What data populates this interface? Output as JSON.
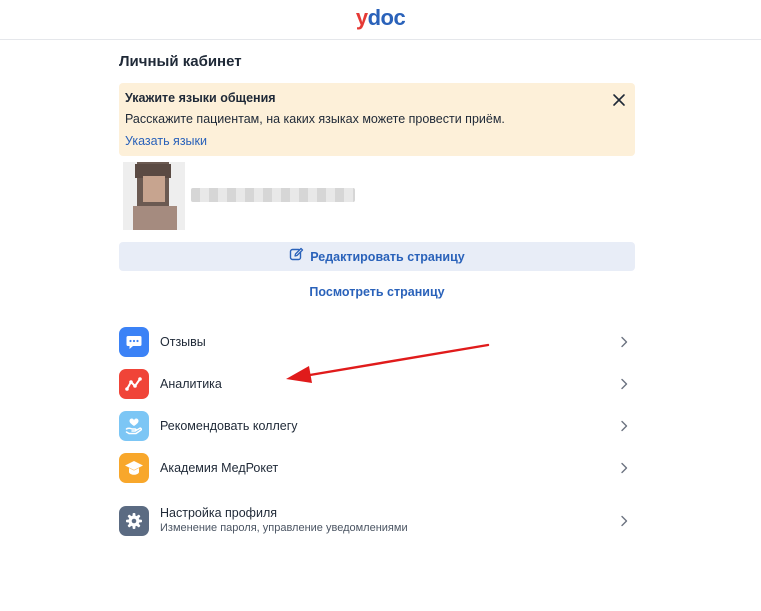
{
  "header": {
    "logo_y": "y",
    "logo_rest": "doc"
  },
  "page": {
    "title": "Личный кабинет"
  },
  "notice": {
    "title": "Укажите языки общения",
    "text": "Расскажите пациентам, на каких языках можете провести приём.",
    "link": "Указать языки",
    "bg_color": "#fdf0d9"
  },
  "profile": {
    "edit_label": "Редактировать страницу",
    "view_label": "Посмотреть страницу"
  },
  "menu": [
    {
      "label": "Отзывы",
      "icon": "chat-icon",
      "color": "#3b82f6"
    },
    {
      "label": "Аналитика",
      "icon": "analytics-icon",
      "color": "#f04438"
    },
    {
      "label": "Рекомендовать коллегу",
      "icon": "heart-hand-icon",
      "color": "#7cc6f5"
    },
    {
      "label": "Академия МедРокет",
      "icon": "graduation-cap-icon",
      "color": "#f8a72b"
    },
    {
      "label": "Настройка профиля",
      "sub": "Изменение пароля, управление уведомлениями",
      "icon": "gear-icon",
      "color": "#5b6b82"
    }
  ],
  "colors": {
    "accent": "#2a62ba",
    "annotation_arrow": "#e01b1b"
  }
}
